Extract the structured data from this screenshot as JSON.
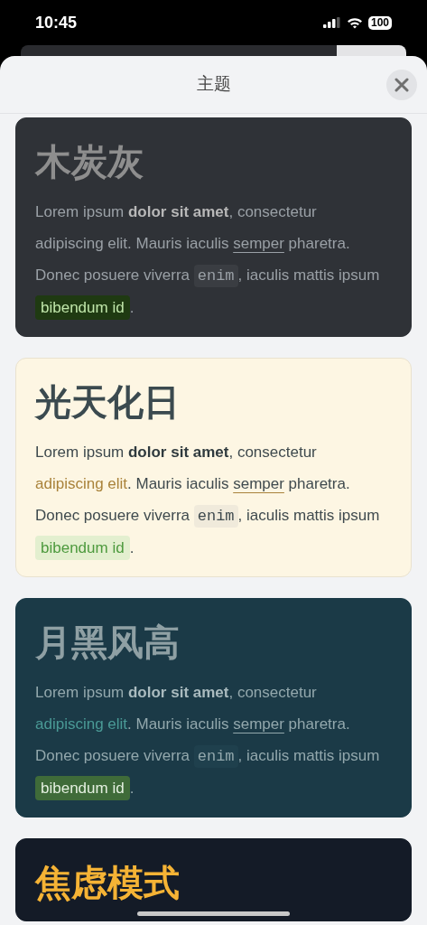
{
  "status_bar": {
    "time": "10:45",
    "battery": "100"
  },
  "sheet": {
    "title": "主题"
  },
  "themes": [
    {
      "kind": "charcoal",
      "title": "木炭灰",
      "paragraph": [
        {
          "kind": "text",
          "text": "Lorem ipsum "
        },
        {
          "kind": "bold",
          "text": "dolor sit amet"
        },
        {
          "kind": "text",
          "text": ", consectetur "
        },
        {
          "kind": "link",
          "text": "adipiscing elit"
        },
        {
          "kind": "text",
          "text": ". Mauris iaculis "
        },
        {
          "kind": "underline",
          "text": "semper"
        },
        {
          "kind": "text",
          "text": " pharetra. Donec posuere viverra "
        },
        {
          "kind": "code",
          "text": "enim"
        },
        {
          "kind": "text",
          "text": ", iaculis mattis ipsum "
        },
        {
          "kind": "mark",
          "text": "bibendum id"
        },
        {
          "kind": "text",
          "text": "."
        }
      ]
    },
    {
      "kind": "solarized",
      "title": "光天化日",
      "paragraph": [
        {
          "kind": "text",
          "text": "Lorem ipsum "
        },
        {
          "kind": "bold",
          "text": "dolor sit amet"
        },
        {
          "kind": "text",
          "text": ", consectetur "
        },
        {
          "kind": "link",
          "text": "adipiscing elit"
        },
        {
          "kind": "text",
          "text": ". Mauris iaculis "
        },
        {
          "kind": "underline",
          "text": "semper"
        },
        {
          "kind": "text",
          "text": " pharetra. Donec posuere viverra "
        },
        {
          "kind": "code",
          "text": "enim"
        },
        {
          "kind": "text",
          "text": ", iaculis mattis ipsum "
        },
        {
          "kind": "mark",
          "text": "bibendum id"
        },
        {
          "kind": "text",
          "text": "."
        }
      ]
    },
    {
      "kind": "midnight",
      "title": "月黑风高",
      "paragraph": [
        {
          "kind": "text",
          "text": "Lorem ipsum "
        },
        {
          "kind": "bold",
          "text": "dolor sit amet"
        },
        {
          "kind": "text",
          "text": ", consectetur "
        },
        {
          "kind": "link",
          "text": "adipiscing elit"
        },
        {
          "kind": "text",
          "text": ". Mauris iaculis "
        },
        {
          "kind": "underline",
          "text": "semper"
        },
        {
          "kind": "text",
          "text": " pharetra. Donec posuere viverra "
        },
        {
          "kind": "code",
          "text": "enim"
        },
        {
          "kind": "text",
          "text": ", iaculis mattis ipsum "
        },
        {
          "kind": "mark",
          "text": "bibendum id"
        },
        {
          "kind": "text",
          "text": "."
        }
      ]
    },
    {
      "kind": "anxiety",
      "title": "焦虑模式"
    }
  ]
}
